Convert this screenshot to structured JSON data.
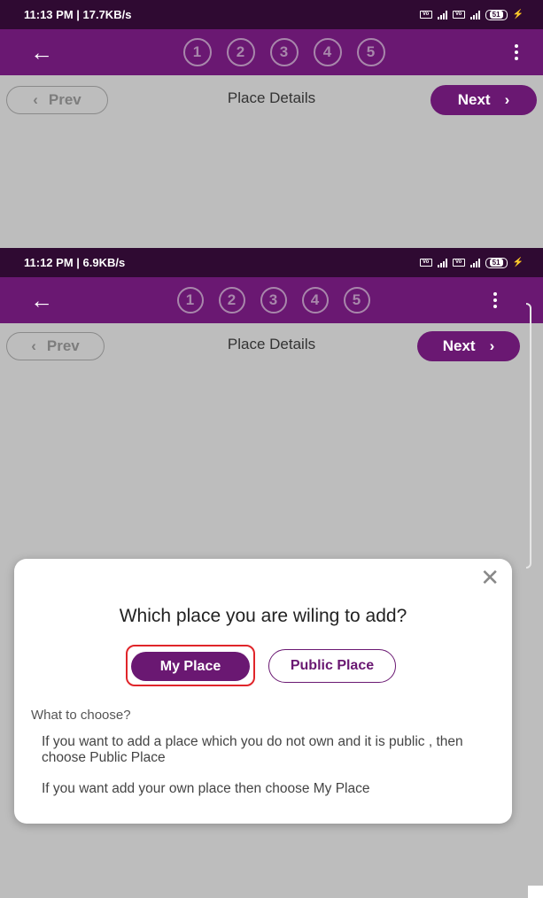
{
  "screens": [
    {
      "status": {
        "time": "11:13 PM | 17.7KB/s",
        "battery": "51"
      },
      "steps": [
        "1",
        "2",
        "3",
        "4",
        "5"
      ],
      "prev_label": "Prev",
      "title": "Place Details",
      "next_label": "Next"
    },
    {
      "status": {
        "time": "11:12 PM | 6.9KB/s",
        "battery": "51"
      },
      "steps": [
        "1",
        "2",
        "3",
        "4",
        "5"
      ],
      "prev_label": "Prev",
      "title": "Place Details",
      "next_label": "Next"
    }
  ],
  "dialog": {
    "question": "Which place you are wiling to add?",
    "my_place": "My Place",
    "public_place": "Public Place",
    "what_to_choose": "What to choose?",
    "public_help": "If you want to add a place which you do not own and it is public , then choose Public Place",
    "own_help": "If you want add your own place then choose My Place"
  },
  "icons": {
    "back": "arrow-left-icon",
    "menu": "more-vert-icon",
    "close": "close-icon",
    "prev": "chevron-left-icon",
    "next": "chevron-right-icon"
  },
  "colors": {
    "appbar": "#6a1872",
    "statusbar": "#2f0a32",
    "primary": "#6a1872",
    "highlight": "#e0252a"
  }
}
